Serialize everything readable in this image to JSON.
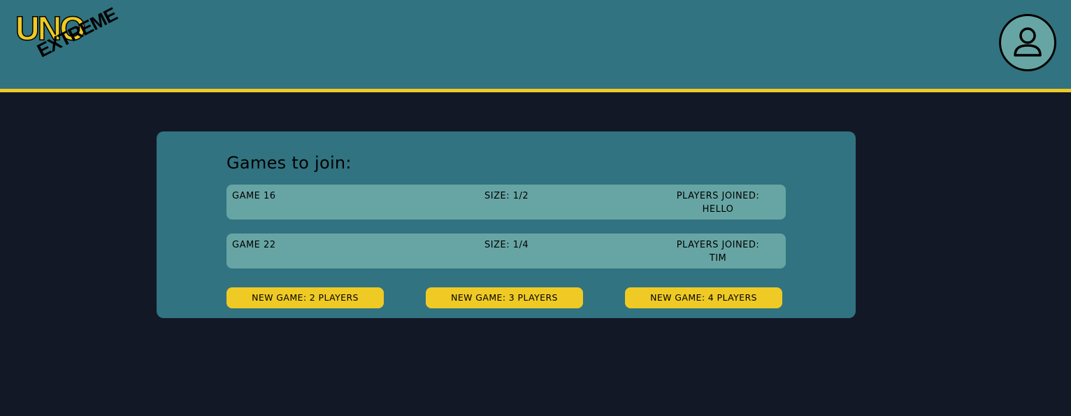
{
  "header": {
    "logo": {
      "line1": "UNO",
      "line2": "EXTREME"
    },
    "avatar_icon": "user-icon",
    "colors": {
      "bar": "#317380",
      "accent": "#efca25"
    }
  },
  "lobby": {
    "title": "Games to join:",
    "games": [
      {
        "name": "GAME 16",
        "size": "SIZE: 1/2",
        "players_label": "PLAYERS JOINED:",
        "players": "HELLO"
      },
      {
        "name": "GAME 22",
        "size": "SIZE: 1/4",
        "players_label": "PLAYERS JOINED:",
        "players": "TIM"
      }
    ],
    "buttons": [
      {
        "label": "NEW GAME: 2 PLAYERS"
      },
      {
        "label": "NEW GAME: 3 PLAYERS"
      },
      {
        "label": "NEW GAME: 4 PLAYERS"
      }
    ]
  }
}
